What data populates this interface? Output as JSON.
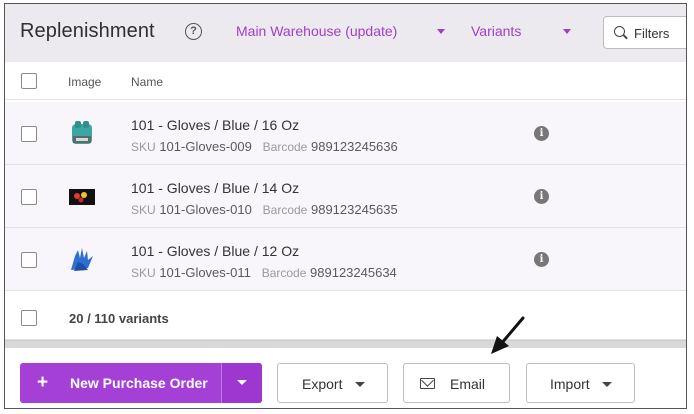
{
  "header": {
    "title": "Replenishment",
    "warehouse_select": "Main Warehouse (update)",
    "view_select": "Variants",
    "filters_label": "Filters"
  },
  "columns": {
    "image": "Image",
    "name": "Name"
  },
  "rows": [
    {
      "name": "101 - Gloves / Blue / 16 Oz",
      "sku_label": "SKU",
      "sku": "101-Gloves-009",
      "barcode_label": "Barcode",
      "barcode": "989123245636"
    },
    {
      "name": "101 - Gloves / Blue / 14 Oz",
      "sku_label": "SKU",
      "sku": "101-Gloves-010",
      "barcode_label": "Barcode",
      "barcode": "989123245635"
    },
    {
      "name": "101 - Gloves / Blue / 12 Oz",
      "sku_label": "SKU",
      "sku": "101-Gloves-011",
      "barcode_label": "Barcode",
      "barcode": "989123245634"
    }
  ],
  "footer": {
    "count_text": "20 / 110 variants"
  },
  "actions": {
    "new_purchase_order": "New Purchase Order",
    "export": "Export",
    "email": "Email",
    "import": "Import"
  },
  "colors": {
    "accent": "#a540d6",
    "header_bg": "#ece9ef",
    "row_bg": "#f8f6fa"
  },
  "icons": {
    "help": "question-circle-icon",
    "search": "search-icon",
    "info": "info-circle-icon",
    "mail": "envelope-icon",
    "plus": "plus-icon",
    "annotation": "arrow-pointer-icon"
  }
}
